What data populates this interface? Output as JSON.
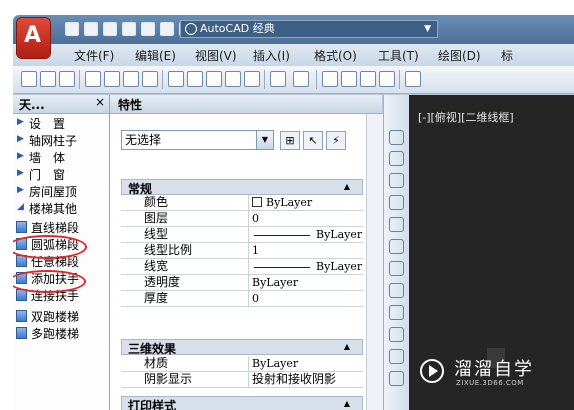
{
  "title_bar": {
    "app_logo": "A",
    "workspace": "AutoCAD 经典"
  },
  "menu": [
    "文件(F)",
    "编辑(E)",
    "视图(V)",
    "插入(I)",
    "格式(O)",
    "工具(T)",
    "绘图(D)",
    "标"
  ],
  "left_panel": {
    "title": "天...",
    "close": "×",
    "items": [
      {
        "label": "设　置",
        "kind": "folder"
      },
      {
        "label": "轴网柱子",
        "kind": "folder"
      },
      {
        "label": "墙　体",
        "kind": "folder"
      },
      {
        "label": "门　窗",
        "kind": "folder"
      },
      {
        "label": "房间屋顶",
        "kind": "folder"
      },
      {
        "label": "楼梯其他",
        "kind": "folder-open"
      },
      {
        "label": "直线梯段",
        "kind": "tool"
      },
      {
        "label": "圆弧梯段",
        "kind": "tool"
      },
      {
        "label": "任意梯段",
        "kind": "tool"
      },
      {
        "label": "添加扶手",
        "kind": "tool"
      },
      {
        "label": "连接扶手",
        "kind": "tool"
      },
      {
        "label": "双跑楼梯",
        "kind": "tool"
      },
      {
        "label": "多跑楼梯",
        "kind": "tool"
      }
    ]
  },
  "properties": {
    "title": "特性",
    "selection": "无选择",
    "sections": {
      "general": "常规",
      "three_d": "三维效果",
      "print": "打印样式"
    },
    "general_rows": [
      {
        "key": "颜色",
        "value": "ByLayer",
        "swatch": true
      },
      {
        "key": "图层",
        "value": "0"
      },
      {
        "key": "线型",
        "value": "ByLayer",
        "line": true
      },
      {
        "key": "线型比例",
        "value": "1"
      },
      {
        "key": "线宽",
        "value": "ByLayer",
        "line": true
      },
      {
        "key": "透明度",
        "value": "ByLayer"
      },
      {
        "key": "厚度",
        "value": "0"
      }
    ],
    "three_d_rows": [
      {
        "key": "材质",
        "value": "ByLayer"
      },
      {
        "key": "阴影显示",
        "value": "投射和接收阴影"
      }
    ]
  },
  "viewport": {
    "label": "[-][俯视][二维线框]"
  },
  "watermark": {
    "name": "溜溜自学",
    "url": "ZIXUE.3D66.COM"
  },
  "colors": {
    "annotation_red": "#e0262a",
    "viewport_bg": "#252525"
  }
}
